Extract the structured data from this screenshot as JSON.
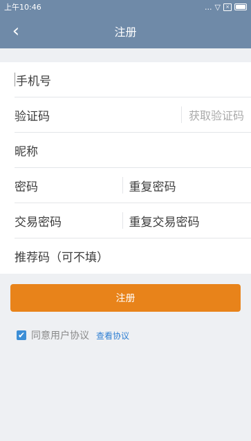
{
  "status": {
    "time": "上午10:46",
    "dots": "...",
    "sim": "×"
  },
  "topbar": {
    "title": "注册"
  },
  "form": {
    "phone_placeholder": "手机号",
    "code_placeholder": "验证码",
    "get_code": "获取验证码",
    "nickname_placeholder": "昵称",
    "password_placeholder": "密码",
    "repeat_password_placeholder": "重复密码",
    "trade_password_placeholder": "交易密码",
    "repeat_trade_password_placeholder": "重复交易密码",
    "referral_placeholder": "推荐码（可不填）"
  },
  "submit_label": "注册",
  "agreement": {
    "label": "同意用户协议",
    "link": "查看协议",
    "checked": true
  }
}
